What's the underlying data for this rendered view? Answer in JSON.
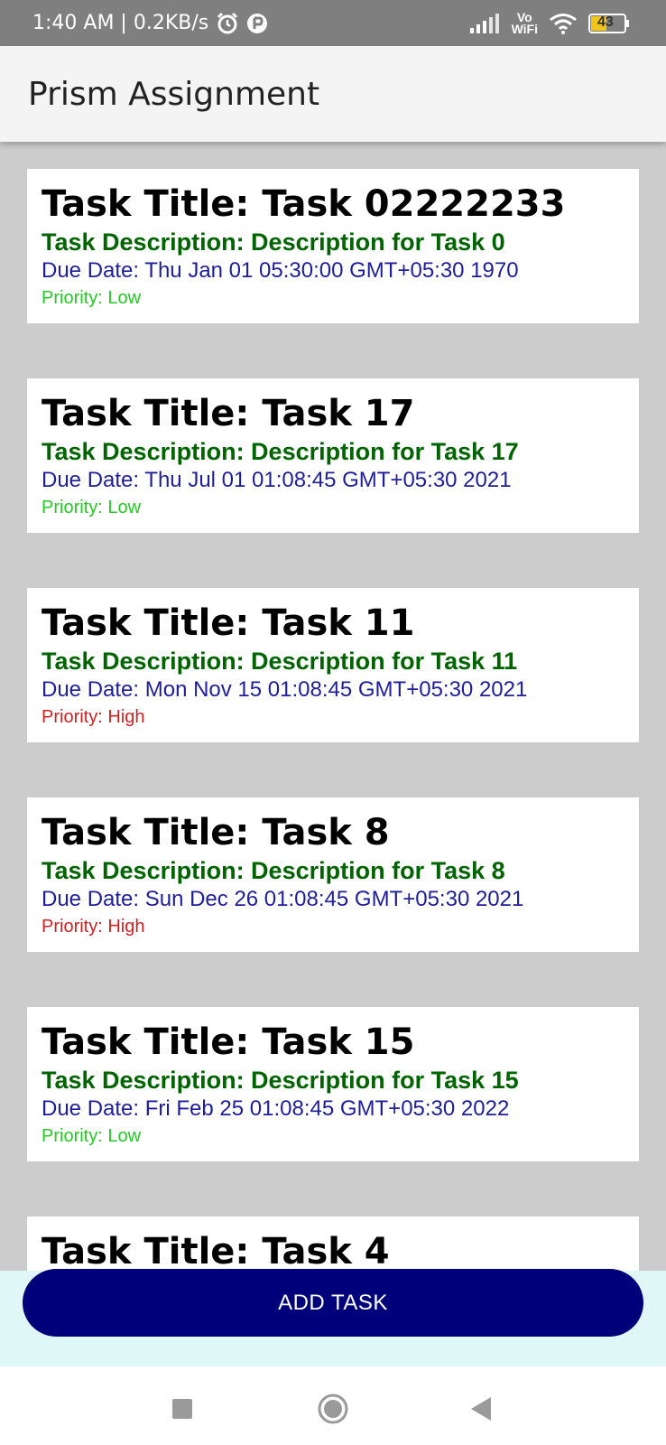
{
  "status_bar": {
    "time_speed": "1:40 AM | 0.2KB/s",
    "vowifi_top": "Vo",
    "vowifi_bottom": "WiFi",
    "battery": "43"
  },
  "app_bar": {
    "title": "Prism Assignment"
  },
  "tasks": [
    {
      "title": "Task Title: Task 02222233",
      "description": "Task Description: Description for Task 0",
      "due": "Due Date: Thu Jan 01 05:30:00 GMT+05:30 1970",
      "priority": "Priority: Low",
      "priority_color": "#22cc22"
    },
    {
      "title": "Task Title: Task 17",
      "description": "Task Description: Description for Task 17",
      "due": "Due Date: Thu Jul 01 01:08:45 GMT+05:30 2021",
      "priority": "Priority: Low",
      "priority_color": "#22cc22"
    },
    {
      "title": "Task Title: Task 11",
      "description": "Task Description: Description for Task 11",
      "due": "Due Date: Mon Nov 15 01:08:45 GMT+05:30 2021",
      "priority": "Priority: High",
      "priority_color": "#d42020"
    },
    {
      "title": "Task Title: Task 8",
      "description": "Task Description: Description for Task 8",
      "due": "Due Date: Sun Dec 26 01:08:45 GMT+05:30 2021",
      "priority": "Priority: High",
      "priority_color": "#d42020"
    },
    {
      "title": "Task Title: Task 15",
      "description": "Task Description: Description for Task 15",
      "due": "Due Date: Fri Feb 25 01:08:45 GMT+05:30 2022",
      "priority": "Priority: Low",
      "priority_color": "#22cc22"
    },
    {
      "title": "Task Title: Task 4",
      "description": "",
      "due": "",
      "priority": "",
      "priority_color": "#22cc22"
    }
  ],
  "add_button": {
    "label": "ADD TASK",
    "color": "#00007a"
  },
  "nav": {
    "recents_icon": "square-icon",
    "home_icon": "circle-icon",
    "back_icon": "triangle-back-icon"
  }
}
